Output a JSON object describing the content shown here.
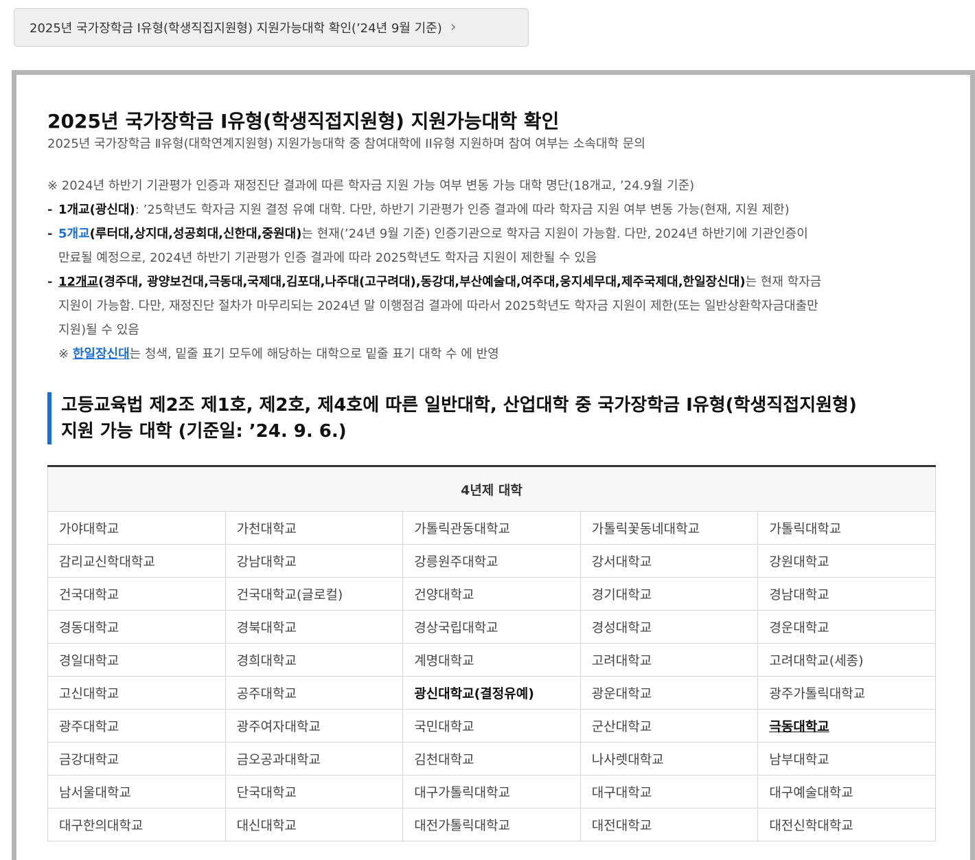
{
  "top_link": {
    "label": "2025년 국가장학금 Ⅰ유형(학생직집지원형) 지원가능대학 확인(’24년 9월 기준)",
    "chevron": "›"
  },
  "main": {
    "title": "2025년 국가장학금 Ⅰ유형(학생직접지원형) 지원가능대학 확인",
    "subtitle": "2025년 국가장학금 Ⅱ유형(대학연계지원형) 지원가능대학 중 참여대학에 II유형 지원하며 참여 여부는 소속대학 문의"
  },
  "notes": {
    "intro": "※ 2024년 하반기 기관평가 인증과 재정진단 결과에 따른 학자금 지원 가능 여부 변동 가능 대학 명단(18개교, ’24.9월 기준)",
    "dash": "-",
    "item1_bold": "1개교(광신대)",
    "item1_text": ": ’25학년도 학자금 지원 결정 유예 대학. 다만, 하반기 기관평가 인증 결과에 따라 학자금 지원 여부 변동 가능(현재, 지원 제한)",
    "item2_count": "5개교",
    "item2_names": "(루터대,상지대,성공회대,신한대,중원대)",
    "item2_text1": "는 현재(’24년 9월 기준) 인증기관으로 학자금 지원이 가능함. 다만, 2024년 하반기에 기관인증이",
    "item2_text2": "만료될 예정으로, 2024년 하반기 기관평가 인증 결과에 따라 2025학년도 학자금 지원이 제한될 수 있음",
    "item3_count": "12개교",
    "item3_names": "(경주대, 광양보건대,극동대,국제대,김포대,나주대(고구려대),동강대,부산예술대,여주대,웅지세무대,제주국제대,한일장신대)",
    "item3_text1": "는 현재 학자금",
    "item3_text2": "지원이 가능함. 다만, 재정진단 절차가 마무리되는 2024년 말 이행점검 결과에 따라서 2025학년도 학자금 지원이 제한(또는 일반상환학자금대출만",
    "item3_text3": "지원)될 수 있음",
    "footnote_mark": "※",
    "footnote_link": "한일장신대",
    "footnote_text": "는 청색, 밑줄 표기 모두에 해당하는 대학으로 밑줄 표기 대학 수 에 반영"
  },
  "section": {
    "line1": "고등교육법 제2조 제1호, 제2호, 제4호에 따른 일반대학, 산업대학 중 국가장학금 Ⅰ유형(학생직접지원형)",
    "line2": "지원 가능 대학 (기준일: ’24. 9. 6.)"
  },
  "table": {
    "header": "4년제 대학",
    "rows": [
      [
        "가야대학교",
        "가천대학교",
        "가톨릭관동대학교",
        "가톨릭꽃동네대학교",
        "가톨릭대학교"
      ],
      [
        "감리교신학대학교",
        "강남대학교",
        "강릉원주대학교",
        "강서대학교",
        "강원대학교"
      ],
      [
        "건국대학교",
        "건국대학교(글로컬)",
        "건양대학교",
        "경기대학교",
        "경남대학교"
      ],
      [
        "경동대학교",
        "경북대학교",
        "경상국립대학교",
        "경성대학교",
        "경운대학교"
      ],
      [
        "경일대학교",
        "경희대학교",
        "계명대학교",
        "고려대학교",
        "고려대학교(세종)"
      ],
      [
        "고신대학교",
        "공주대학교",
        "광신대학교(결정유예)",
        "광운대학교",
        "광주가톨릭대학교"
      ],
      [
        "광주대학교",
        "광주여자대학교",
        "국민대학교",
        "군산대학교",
        "극동대학교"
      ],
      [
        "금강대학교",
        "금오공과대학교",
        "김천대학교",
        "나사렛대학교",
        "남부대학교"
      ],
      [
        "남서울대학교",
        "단국대학교",
        "대구가톨릭대학교",
        "대구대학교",
        "대구예술대학교"
      ],
      [
        "대구한의대학교",
        "대신대학교",
        "대전가톨릭대학교",
        "대전대학교",
        "대전신학대학교"
      ]
    ]
  }
}
